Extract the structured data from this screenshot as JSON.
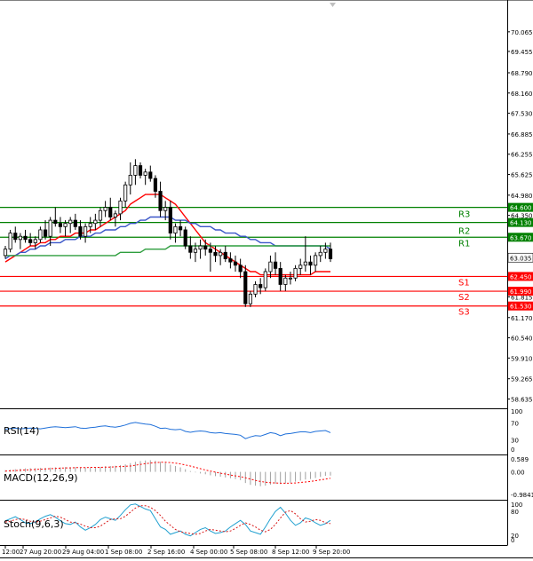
{
  "chart_data": [
    {
      "type": "candlestick",
      "title": "",
      "ylim": [
        58.4,
        71.0
      ],
      "y_ticks": [
        "70.065",
        "69.455",
        "68.790",
        "68.160",
        "67.530",
        "66.885",
        "66.255",
        "65.625",
        "64.980",
        "64.350",
        "63.705",
        "63.035",
        "62.450",
        "61.815",
        "61.170",
        "60.540",
        "59.910",
        "59.265",
        "58.635"
      ],
      "x_ticks": [
        "12:00",
        "27 Aug 20:00",
        "29 Aug 04:00",
        "1 Sep 08:00",
        "2 Sep 16:00",
        "4 Sep 00:00",
        "5 Sep 08:00",
        "8 Sep 12:00",
        "9 Sep 20:00"
      ],
      "last_price": "63.035",
      "candles": [
        [
          63.1,
          63.4,
          63.0,
          63.3
        ],
        [
          63.3,
          63.9,
          63.2,
          63.8
        ],
        [
          63.8,
          64.0,
          63.5,
          63.6
        ],
        [
          63.6,
          63.8,
          63.3,
          63.7
        ],
        [
          63.7,
          63.9,
          63.5,
          63.6
        ],
        [
          63.6,
          63.8,
          63.4,
          63.5
        ],
        [
          63.5,
          63.7,
          63.3,
          63.6
        ],
        [
          63.6,
          64.0,
          63.5,
          63.9
        ],
        [
          63.9,
          64.2,
          63.6,
          63.7
        ],
        [
          63.7,
          64.3,
          63.4,
          64.2
        ],
        [
          64.2,
          64.6,
          64.0,
          64.1
        ],
        [
          64.1,
          64.3,
          63.8,
          64.0
        ],
        [
          64.0,
          64.2,
          63.7,
          64.1
        ],
        [
          64.1,
          64.3,
          63.8,
          64.2
        ],
        [
          64.2,
          64.4,
          63.9,
          64.0
        ],
        [
          64.0,
          64.2,
          63.6,
          63.7
        ],
        [
          63.7,
          64.1,
          63.5,
          64.0
        ],
        [
          64.0,
          64.3,
          63.8,
          64.1
        ],
        [
          64.1,
          64.4,
          63.9,
          64.2
        ],
        [
          64.2,
          64.6,
          64.0,
          64.5
        ],
        [
          64.5,
          64.8,
          64.3,
          64.6
        ],
        [
          64.6,
          64.9,
          64.2,
          64.3
        ],
        [
          64.3,
          64.5,
          64.0,
          64.4
        ],
        [
          64.4,
          64.9,
          64.2,
          64.8
        ],
        [
          64.8,
          65.4,
          64.6,
          65.3
        ],
        [
          65.3,
          66.0,
          65.0,
          65.6
        ],
        [
          65.6,
          66.1,
          65.3,
          65.9
        ],
        [
          65.9,
          66.0,
          65.5,
          65.6
        ],
        [
          65.6,
          65.8,
          65.3,
          65.7
        ],
        [
          65.7,
          65.9,
          65.4,
          65.5
        ],
        [
          65.5,
          65.6,
          64.9,
          65.1
        ],
        [
          65.1,
          65.4,
          64.3,
          64.5
        ],
        [
          64.5,
          64.8,
          64.2,
          64.6
        ],
        [
          64.6,
          64.8,
          63.6,
          63.8
        ],
        [
          63.8,
          64.1,
          63.5,
          64.0
        ],
        [
          64.0,
          64.2,
          63.7,
          63.9
        ],
        [
          63.9,
          64.0,
          63.3,
          63.4
        ],
        [
          63.4,
          63.7,
          63.0,
          63.2
        ],
        [
          63.2,
          63.5,
          62.9,
          63.3
        ],
        [
          63.3,
          63.6,
          63.0,
          63.4
        ],
        [
          63.4,
          63.6,
          63.1,
          63.3
        ],
        [
          63.3,
          63.5,
          62.6,
          63.2
        ],
        [
          63.2,
          63.4,
          62.9,
          63.1
        ],
        [
          63.1,
          63.3,
          62.8,
          63.2
        ],
        [
          63.2,
          63.4,
          62.9,
          63.0
        ],
        [
          63.0,
          63.2,
          62.7,
          62.9
        ],
        [
          62.9,
          63.1,
          62.6,
          62.8
        ],
        [
          62.8,
          63.0,
          62.4,
          62.6
        ],
        [
          62.6,
          62.8,
          61.5,
          61.6
        ],
        [
          61.6,
          62.0,
          61.5,
          61.9
        ],
        [
          61.9,
          62.3,
          61.8,
          62.2
        ],
        [
          62.2,
          62.4,
          61.9,
          62.1
        ],
        [
          62.1,
          62.7,
          62.0,
          62.6
        ],
        [
          62.6,
          63.1,
          62.4,
          62.9
        ],
        [
          62.9,
          63.2,
          62.5,
          62.7
        ],
        [
          62.7,
          62.9,
          62.0,
          62.2
        ],
        [
          62.2,
          62.5,
          62.0,
          62.4
        ],
        [
          62.4,
          62.6,
          62.2,
          62.4
        ],
        [
          62.4,
          62.8,
          62.3,
          62.7
        ],
        [
          62.7,
          63.0,
          62.5,
          62.8
        ],
        [
          62.8,
          63.7,
          62.6,
          62.9
        ],
        [
          62.9,
          63.1,
          62.5,
          62.8
        ],
        [
          62.8,
          63.2,
          62.6,
          63.1
        ],
        [
          63.1,
          63.4,
          62.9,
          63.2
        ],
        [
          63.2,
          63.5,
          63.0,
          63.3
        ],
        [
          63.3,
          63.5,
          62.9,
          63.0
        ]
      ],
      "series": [
        {
          "color": "#ff0000",
          "values": [
            62.9,
            63.0,
            63.1,
            63.2,
            63.3,
            63.4,
            63.4,
            63.5,
            63.5,
            63.6,
            63.6,
            63.7,
            63.7,
            63.7,
            63.8,
            63.8,
            63.8,
            63.9,
            63.9,
            64.0,
            64.1,
            64.2,
            64.3,
            64.4,
            64.5,
            64.7,
            64.8,
            64.9,
            65.0,
            65.0,
            65.0,
            65.0,
            64.9,
            64.8,
            64.7,
            64.5,
            64.3,
            64.1,
            63.9,
            63.7,
            63.5,
            63.4,
            63.3,
            63.2,
            63.1,
            63.0,
            62.9,
            62.8,
            62.7,
            62.6,
            62.6,
            62.5,
            62.5,
            62.5,
            62.5,
            62.5,
            62.5,
            62.5,
            62.5,
            62.5,
            62.5,
            62.5,
            62.6,
            62.6,
            62.6,
            62.6
          ]
        },
        {
          "color": "#3a56c8",
          "values": [
            63.0,
            63.1,
            63.1,
            63.2,
            63.2,
            63.3,
            63.3,
            63.4,
            63.4,
            63.5,
            63.5,
            63.5,
            63.6,
            63.6,
            63.6,
            63.7,
            63.7,
            63.7,
            63.8,
            63.8,
            63.9,
            63.9,
            63.9,
            64.0,
            64.0,
            64.1,
            64.1,
            64.2,
            64.2,
            64.3,
            64.3,
            64.3,
            64.3,
            64.3,
            64.2,
            64.2,
            64.2,
            64.1,
            64.1,
            64.0,
            64.0,
            64.0,
            63.9,
            63.9,
            63.8,
            63.8,
            63.8,
            63.7,
            63.7,
            63.6,
            63.6,
            63.5,
            63.5,
            63.5,
            63.4,
            63.4,
            63.4,
            63.4,
            63.4,
            63.4,
            63.4,
            63.4,
            63.4,
            63.4,
            63.4,
            63.3
          ]
        },
        {
          "color": "#2e9e3e",
          "values": [
            63.1,
            63.1,
            63.1,
            63.1,
            63.1,
            63.1,
            63.1,
            63.1,
            63.1,
            63.1,
            63.1,
            63.1,
            63.1,
            63.1,
            63.1,
            63.1,
            63.1,
            63.1,
            63.1,
            63.1,
            63.1,
            63.1,
            63.1,
            63.2,
            63.2,
            63.2,
            63.2,
            63.2,
            63.3,
            63.3,
            63.3,
            63.3,
            63.3,
            63.4,
            63.4,
            63.4,
            63.4,
            63.4,
            63.4,
            63.4,
            63.4,
            63.4,
            63.4,
            63.4,
            63.4,
            63.4,
            63.4,
            63.4,
            63.4,
            63.4,
            63.4,
            63.4,
            63.4,
            63.4,
            63.4,
            63.4,
            63.4,
            63.4,
            63.4,
            63.4,
            63.4,
            63.4,
            63.4,
            63.4,
            63.4,
            63.4
          ]
        }
      ],
      "levels": [
        {
          "label": "R3",
          "value": 64.6,
          "tag": "64.600",
          "color": "#008000"
        },
        {
          "label": "",
          "value": 64.13,
          "tag": "64.130",
          "color": "#008000"
        },
        {
          "label": "R2",
          "value": 63.67,
          "tag": "63.670",
          "color": "#008000"
        },
        {
          "label": "R1",
          "value": 63.67,
          "tag": "",
          "color": "#008000"
        },
        {
          "label": "S1",
          "value": 62.45,
          "tag": "62.450",
          "color": "#ff0000"
        },
        {
          "label": "S2",
          "value": 61.99,
          "tag": "61.990",
          "color": "#ff0000"
        },
        {
          "label": "S3",
          "value": 61.53,
          "tag": "61.530",
          "color": "#ff0000"
        }
      ]
    },
    {
      "type": "line",
      "name": "RSI(14)",
      "y_ticks": [
        "100",
        "70",
        "30",
        "0"
      ],
      "ylim": [
        0,
        100
      ],
      "series": [
        {
          "color": "#1e6fd9",
          "values": [
            55,
            57,
            58,
            56,
            57,
            58,
            57,
            56,
            58,
            60,
            61,
            60,
            59,
            60,
            61,
            58,
            57,
            59,
            60,
            62,
            63,
            61,
            60,
            62,
            65,
            69,
            71,
            69,
            67,
            66,
            62,
            57,
            58,
            55,
            54,
            55,
            50,
            48,
            50,
            51,
            50,
            47,
            46,
            47,
            45,
            44,
            43,
            41,
            33,
            37,
            40,
            39,
            43,
            47,
            45,
            40,
            44,
            45,
            47,
            49,
            49,
            47,
            50,
            51,
            52,
            47
          ]
        }
      ]
    },
    {
      "type": "bar",
      "name": "MACD(12,26,9)",
      "y_ticks": [
        "0.589",
        "0.00",
        "-0.9841"
      ],
      "ylim": [
        -0.9841,
        0.589
      ],
      "values": [
        0.06,
        0.08,
        0.1,
        0.12,
        0.13,
        0.14,
        0.14,
        0.15,
        0.15,
        0.16,
        0.17,
        0.17,
        0.18,
        0.18,
        0.18,
        0.17,
        0.17,
        0.17,
        0.18,
        0.19,
        0.21,
        0.22,
        0.23,
        0.25,
        0.28,
        0.33,
        0.38,
        0.41,
        0.43,
        0.44,
        0.42,
        0.38,
        0.34,
        0.27,
        0.22,
        0.17,
        0.1,
        0.03,
        -0.02,
        -0.06,
        -0.09,
        -0.13,
        -0.16,
        -0.18,
        -0.21,
        -0.24,
        -0.27,
        -0.31,
        -0.42,
        -0.49,
        -0.52,
        -0.54,
        -0.52,
        -0.48,
        -0.45,
        -0.46,
        -0.44,
        -0.41,
        -0.37,
        -0.33,
        -0.29,
        -0.27,
        -0.23,
        -0.19,
        -0.15,
        -0.14
      ],
      "series": [
        {
          "color": "#ff0000",
          "values": [
            0.03,
            0.04,
            0.05,
            0.06,
            0.07,
            0.08,
            0.09,
            0.1,
            0.11,
            0.12,
            0.13,
            0.14,
            0.15,
            0.15,
            0.16,
            0.16,
            0.16,
            0.17,
            0.17,
            0.17,
            0.18,
            0.18,
            0.19,
            0.2,
            0.21,
            0.22,
            0.25,
            0.28,
            0.31,
            0.33,
            0.35,
            0.36,
            0.36,
            0.35,
            0.33,
            0.3,
            0.26,
            0.22,
            0.17,
            0.12,
            0.07,
            0.03,
            -0.01,
            -0.05,
            -0.08,
            -0.12,
            -0.15,
            -0.18,
            -0.22,
            -0.27,
            -0.32,
            -0.36,
            -0.39,
            -0.41,
            -0.42,
            -0.43,
            -0.43,
            -0.43,
            -0.42,
            -0.4,
            -0.38,
            -0.36,
            -0.33,
            -0.3,
            -0.27,
            -0.24
          ]
        }
      ]
    },
    {
      "type": "line",
      "name": "Stoch(9,6,3)",
      "y_ticks": [
        "100",
        "80",
        "20",
        "0"
      ],
      "ylim": [
        0,
        100
      ],
      "series": [
        {
          "color": "#20a0d0",
          "values": [
            55,
            60,
            65,
            58,
            50,
            48,
            52,
            60,
            66,
            70,
            64,
            55,
            48,
            46,
            52,
            40,
            32,
            38,
            46,
            58,
            64,
            60,
            56,
            68,
            82,
            94,
            96,
            90,
            84,
            80,
            60,
            40,
            34,
            22,
            26,
            30,
            22,
            18,
            26,
            34,
            38,
            30,
            24,
            26,
            30,
            40,
            48,
            56,
            46,
            30,
            26,
            22,
            40,
            60,
            78,
            88,
            74,
            56,
            44,
            50,
            62,
            58,
            50,
            44,
            48,
            56
          ]
        },
        {
          "color": "#d81818",
          "values": [
            52,
            54,
            58,
            60,
            58,
            54,
            52,
            54,
            58,
            62,
            66,
            64,
            58,
            52,
            50,
            47,
            42,
            38,
            38,
            42,
            50,
            58,
            60,
            60,
            66,
            76,
            86,
            92,
            92,
            88,
            80,
            68,
            54,
            44,
            34,
            28,
            26,
            24,
            22,
            24,
            30,
            34,
            32,
            30,
            28,
            30,
            36,
            44,
            50,
            46,
            40,
            32,
            28,
            34,
            46,
            62,
            76,
            80,
            72,
            60,
            52,
            54,
            58,
            56,
            50,
            48
          ]
        }
      ]
    }
  ]
}
